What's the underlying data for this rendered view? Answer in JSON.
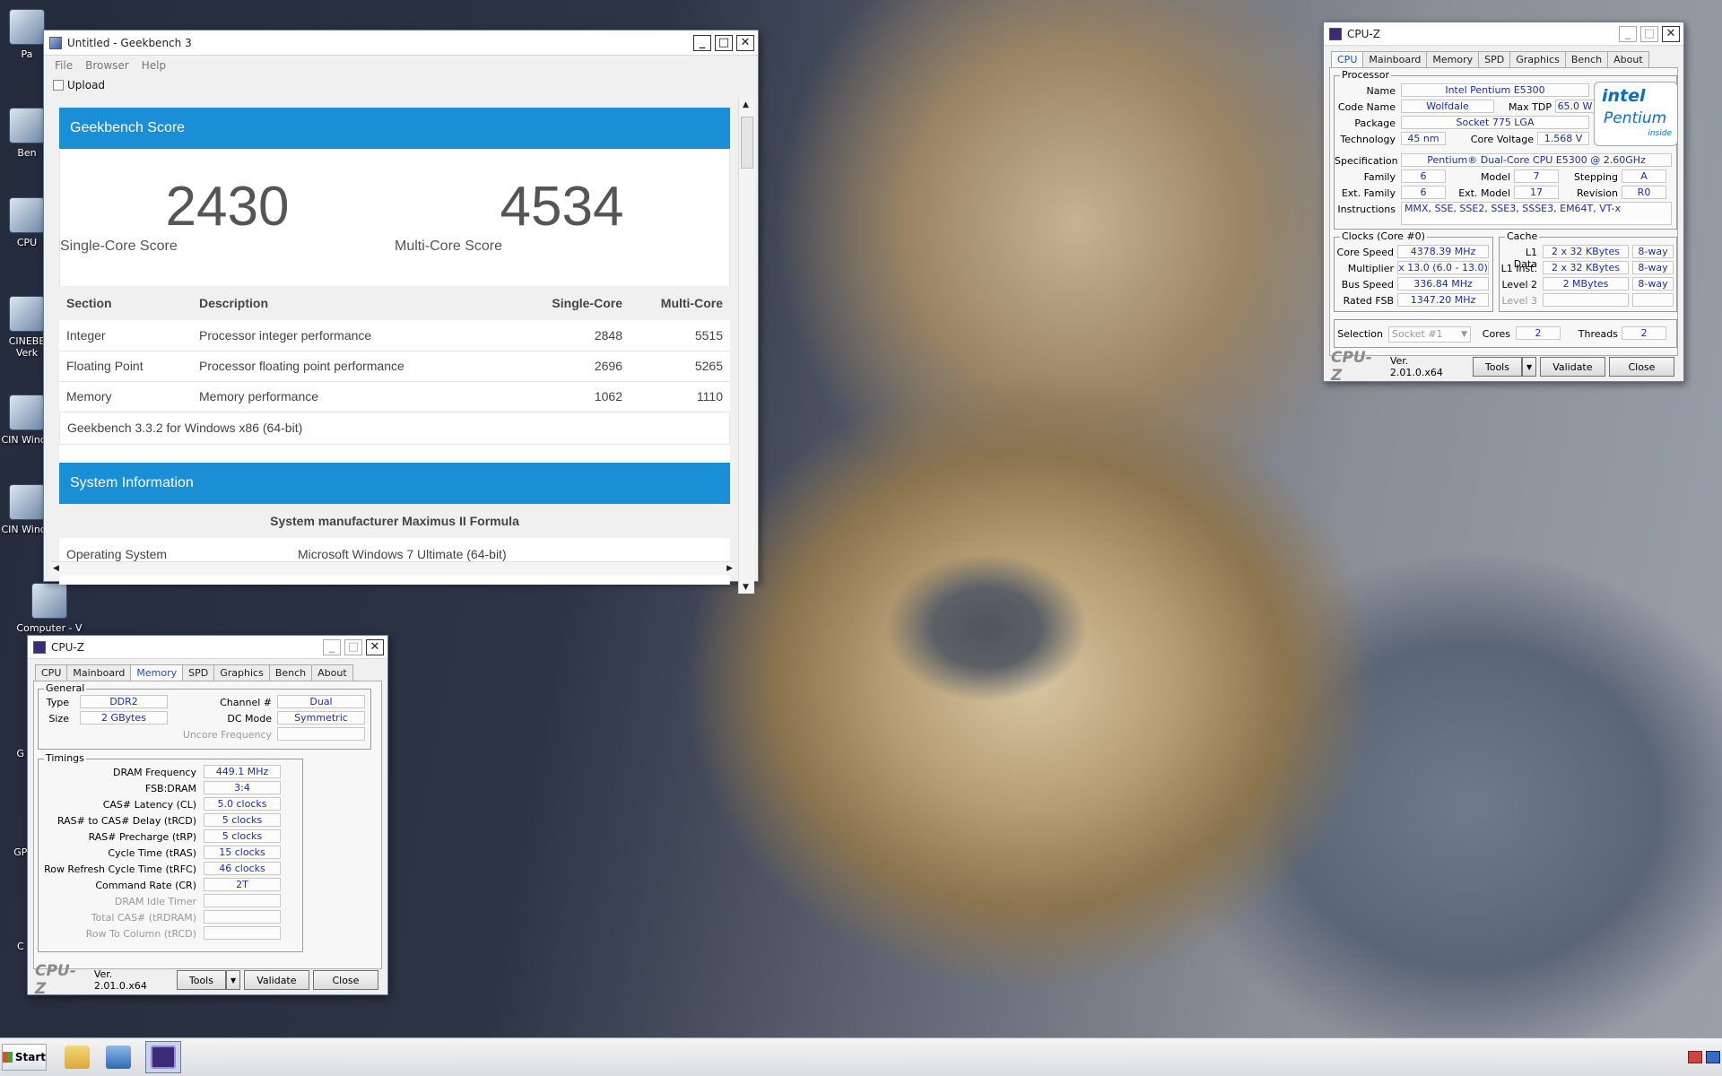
{
  "desktop": {
    "icons": [
      "Pa",
      "Ben",
      "CPU",
      "CINEBE Verk",
      "CIN Windo",
      "CIN Windo",
      "Computer - V",
      "G W",
      "GP W",
      "C W"
    ]
  },
  "geekbench": {
    "title": "Untitled - Geekbench 3",
    "menu": [
      "File",
      "Browser",
      "Help"
    ],
    "upload": "Upload",
    "score_header": "Geekbench Score",
    "single_score": "2430",
    "single_label": "Single-Core Score",
    "multi_score": "4534",
    "multi_label": "Multi-Core Score",
    "columns": [
      "Section",
      "Description",
      "Single-Core",
      "Multi-Core"
    ],
    "rows": [
      {
        "section": "Integer",
        "desc": "Processor integer performance",
        "single": "2848",
        "multi": "5515"
      },
      {
        "section": "Floating Point",
        "desc": "Processor floating point performance",
        "single": "2696",
        "multi": "5265"
      },
      {
        "section": "Memory",
        "desc": "Memory performance",
        "single": "1062",
        "multi": "1110"
      }
    ],
    "version_note": "Geekbench 3.3.2 for Windows x86 (64-bit)",
    "sysinfo_header": "System Information",
    "system_manufacturer": "System manufacturer Maximus II Formula",
    "os_label": "Operating System",
    "os_value": "Microsoft Windows 7 Ultimate (64-bit)"
  },
  "cpuz_cpu": {
    "title": "CPU-Z",
    "tabs": [
      "CPU",
      "Mainboard",
      "Memory",
      "SPD",
      "Graphics",
      "Bench",
      "About"
    ],
    "processor_group": "Processor",
    "name_label": "Name",
    "name": "Intel Pentium E5300",
    "codename_label": "Code Name",
    "codename": "Wolfdale",
    "tdp_label": "Max TDP",
    "tdp": "65.0 W",
    "package_label": "Package",
    "package": "Socket 775 LGA",
    "tech_label": "Technology",
    "tech": "45 nm",
    "voltage_label": "Core Voltage",
    "voltage": "1.568 V",
    "spec_label": "Specification",
    "spec": "Pentium® Dual-Core  CPU    E5300  @ 2.60GHz",
    "family_label": "Family",
    "family": "6",
    "model_label": "Model",
    "model": "7",
    "stepping_label": "Stepping",
    "stepping": "A",
    "extfamily_label": "Ext. Family",
    "extfamily": "6",
    "extmodel_label": "Ext. Model",
    "extmodel": "17",
    "revision_label": "Revision",
    "revision": "R0",
    "instr_label": "Instructions",
    "instr": "MMX, SSE, SSE2, SSE3, SSSE3, EM64T, VT-x",
    "clocks_group": "Clocks (Core #0)",
    "corespeed_label": "Core Speed",
    "corespeed": "4378.39 MHz",
    "mult_label": "Multiplier",
    "mult": "x 13.0 (6.0 - 13.0)",
    "bus_label": "Bus Speed",
    "bus": "336.84 MHz",
    "fsb_label": "Rated FSB",
    "fsb": "1347.20 MHz",
    "cache_group": "Cache",
    "l1d_label": "L1 Data",
    "l1d": "2 x 32 KBytes",
    "l1d_way": "8-way",
    "l1i_label": "L1 Inst.",
    "l1i": "2 x 32 KBytes",
    "l1i_way": "8-way",
    "l2_label": "Level 2",
    "l2": "2 MBytes",
    "l2_way": "8-way",
    "l3_label": "Level 3",
    "selection_label": "Selection",
    "selection": "Socket #1",
    "cores_label": "Cores",
    "cores": "2",
    "threads_label": "Threads",
    "threads": "2",
    "logo": "CPU-Z",
    "version": "Ver. 2.01.0.x64",
    "tools": "Tools",
    "validate": "Validate",
    "close": "Close",
    "intel_text": "intel",
    "pentium_text": "Pentium",
    "inside_text": "inside"
  },
  "cpuz_mem": {
    "title": "CPU-Z",
    "tabs": [
      "CPU",
      "Mainboard",
      "Memory",
      "SPD",
      "Graphics",
      "Bench",
      "About"
    ],
    "general_group": "General",
    "type_label": "Type",
    "type": "DDR2",
    "size_label": "Size",
    "size": "2 GBytes",
    "channel_label": "Channel #",
    "channel": "Dual",
    "dcmode_label": "DC Mode",
    "dcmode": "Symmetric",
    "uncore_label": "Uncore Frequency",
    "timings_group": "Timings",
    "timings": [
      {
        "label": "DRAM Frequency",
        "value": "449.1 MHz"
      },
      {
        "label": "FSB:DRAM",
        "value": "3:4"
      },
      {
        "label": "CAS# Latency (CL)",
        "value": "5.0 clocks"
      },
      {
        "label": "RAS# to CAS# Delay (tRCD)",
        "value": "5 clocks"
      },
      {
        "label": "RAS# Precharge (tRP)",
        "value": "5 clocks"
      },
      {
        "label": "Cycle Time (tRAS)",
        "value": "15 clocks"
      },
      {
        "label": "Row Refresh Cycle Time (tRFC)",
        "value": "46 clocks"
      },
      {
        "label": "Command Rate (CR)",
        "value": "2T"
      },
      {
        "label": "DRAM Idle Timer",
        "value": ""
      },
      {
        "label": "Total CAS# (tRDRAM)",
        "value": ""
      },
      {
        "label": "Row To Column (tRCD)",
        "value": ""
      }
    ],
    "logo": "CPU-Z",
    "version": "Ver. 2.01.0.x64",
    "tools": "Tools",
    "validate": "Validate",
    "close": "Close"
  },
  "taskbar": {
    "start": "Start"
  }
}
